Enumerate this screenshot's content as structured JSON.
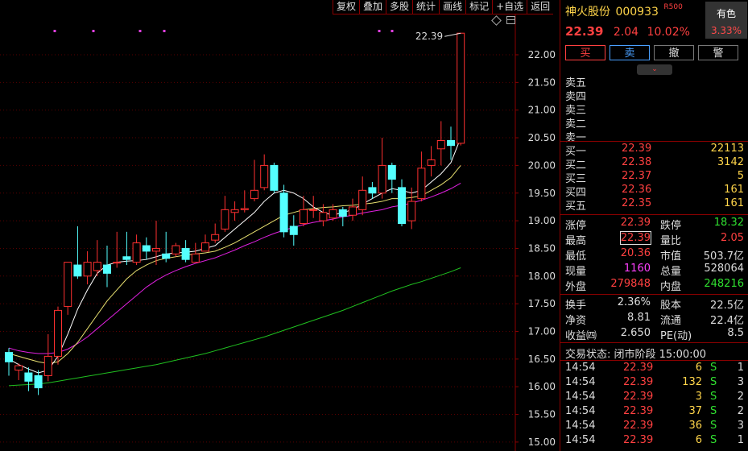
{
  "toolbar": [
    "复权",
    "叠加",
    "多股",
    "统计",
    "画线",
    "标记",
    "+自选",
    "返回"
  ],
  "chart_data": {
    "type": "candlestick",
    "y_ticks": [
      "22.00",
      "21.50",
      "21.00",
      "20.50",
      "20.00",
      "19.50",
      "19.00",
      "18.50",
      "18.00",
      "17.50",
      "17.00",
      "16.50",
      "16.00",
      "15.50",
      "15.00"
    ],
    "high_label": "22.39",
    "ylim": [
      15.0,
      22.5
    ],
    "candles": [
      [
        16.62,
        16.45,
        16.7,
        16.2
      ],
      [
        16.3,
        16.38,
        16.42,
        16.12
      ],
      [
        16.25,
        16.1,
        16.35,
        15.92
      ],
      [
        16.2,
        15.98,
        16.3,
        15.85
      ],
      [
        16.2,
        16.55,
        16.95,
        16.1
      ],
      [
        16.55,
        17.38,
        17.45,
        16.4
      ],
      [
        17.45,
        18.25,
        18.25,
        17.3
      ],
      [
        18.2,
        18.0,
        18.9,
        17.95
      ],
      [
        18.0,
        18.25,
        18.45,
        17.85
      ],
      [
        18.1,
        18.25,
        18.65,
        18.0
      ],
      [
        18.2,
        18.05,
        18.55,
        17.8
      ],
      [
        18.25,
        18.25,
        18.8,
        18.15
      ],
      [
        18.35,
        18.3,
        18.8,
        18.2
      ],
      [
        18.25,
        18.6,
        18.75,
        18.2
      ],
      [
        18.55,
        18.45,
        18.7,
        18.3
      ],
      [
        18.45,
        18.5,
        19.0,
        18.2
      ],
      [
        18.4,
        18.32,
        18.8,
        18.25
      ],
      [
        18.4,
        18.55,
        18.6,
        18.35
      ],
      [
        18.5,
        18.3,
        18.65,
        18.25
      ],
      [
        18.25,
        18.4,
        18.6,
        18.25
      ],
      [
        18.45,
        18.6,
        18.75,
        18.45
      ],
      [
        18.65,
        18.75,
        18.95,
        18.6
      ],
      [
        18.85,
        19.2,
        19.45,
        18.8
      ],
      [
        19.15,
        19.2,
        19.35,
        19.0
      ],
      [
        19.2,
        19.22,
        19.55,
        19.15
      ],
      [
        19.4,
        19.55,
        20.1,
        19.35
      ],
      [
        19.6,
        20.0,
        20.2,
        19.55
      ],
      [
        20.0,
        19.55,
        20.05,
        19.5
      ],
      [
        19.5,
        18.8,
        19.65,
        18.7
      ],
      [
        18.9,
        18.75,
        19.1,
        18.55
      ],
      [
        18.95,
        19.2,
        19.45,
        18.9
      ],
      [
        19.2,
        19.2,
        19.45,
        19.05
      ],
      [
        19.0,
        19.15,
        19.3,
        18.9
      ],
      [
        19.05,
        19.2,
        19.3,
        19.0
      ],
      [
        19.2,
        19.08,
        19.25,
        18.9
      ],
      [
        19.1,
        19.25,
        19.4,
        19.0
      ],
      [
        19.2,
        19.55,
        19.8,
        19.1
      ],
      [
        19.6,
        19.5,
        19.7,
        19.4
      ],
      [
        19.5,
        20.0,
        20.5,
        19.4
      ],
      [
        20.0,
        19.75,
        20.05,
        19.5
      ],
      [
        19.6,
        18.95,
        19.75,
        18.9
      ],
      [
        19.0,
        19.35,
        19.6,
        18.85
      ],
      [
        19.4,
        19.95,
        20.25,
        19.35
      ],
      [
        20.0,
        20.1,
        20.35,
        19.8
      ],
      [
        20.3,
        20.45,
        20.8,
        20.0
      ],
      [
        20.45,
        20.36,
        20.7,
        20.1
      ],
      [
        20.4,
        22.39,
        22.39,
        20.36
      ]
    ],
    "ma5": [
      16.5,
      16.4,
      16.32,
      16.25,
      16.3,
      16.55,
      16.95,
      17.4,
      17.75,
      18.05,
      18.2,
      18.25,
      18.27,
      18.28,
      18.3,
      18.35,
      18.4,
      18.42,
      18.43,
      18.45,
      18.5,
      18.55,
      18.7,
      18.85,
      19.0,
      19.15,
      19.35,
      19.5,
      19.55,
      19.5,
      19.4,
      19.25,
      19.15,
      19.1,
      19.15,
      19.2,
      19.3,
      19.4,
      19.5,
      19.58,
      19.55,
      19.5,
      19.55,
      19.7,
      19.85,
      20.05,
      20.5
    ],
    "ma10": [
      16.6,
      16.55,
      16.5,
      16.45,
      16.42,
      16.45,
      16.6,
      16.8,
      17.05,
      17.3,
      17.55,
      17.75,
      17.95,
      18.1,
      18.2,
      18.28,
      18.32,
      18.35,
      18.38,
      18.4,
      18.42,
      18.45,
      18.52,
      18.6,
      18.7,
      18.8,
      18.9,
      19.0,
      19.1,
      19.15,
      19.2,
      19.22,
      19.24,
      19.25,
      19.27,
      19.28,
      19.3,
      19.32,
      19.35,
      19.4,
      19.4,
      19.42,
      19.45,
      19.55,
      19.65,
      19.78,
      20.0
    ],
    "ma20": [
      16.7,
      16.65,
      16.62,
      16.6,
      16.6,
      16.62,
      16.68,
      16.78,
      16.9,
      17.05,
      17.2,
      17.35,
      17.5,
      17.65,
      17.8,
      17.92,
      18.02,
      18.1,
      18.17,
      18.23,
      18.28,
      18.33,
      18.4,
      18.47,
      18.55,
      18.62,
      18.7,
      18.77,
      18.83,
      18.88,
      18.93,
      18.97,
      19.0,
      19.03,
      19.07,
      19.1,
      19.14,
      19.17,
      19.2,
      19.25,
      19.28,
      19.32,
      19.37,
      19.43,
      19.5,
      19.58,
      19.68
    ],
    "ma60": [
      16.02,
      16.03,
      16.04,
      16.05,
      16.07,
      16.1,
      16.13,
      16.16,
      16.19,
      16.22,
      16.25,
      16.28,
      16.31,
      16.34,
      16.37,
      16.4,
      16.44,
      16.48,
      16.52,
      16.56,
      16.6,
      16.65,
      16.7,
      16.75,
      16.8,
      16.85,
      16.9,
      16.96,
      17.02,
      17.08,
      17.14,
      17.2,
      17.26,
      17.32,
      17.38,
      17.45,
      17.52,
      17.59,
      17.66,
      17.73,
      17.79,
      17.85,
      17.9,
      17.96,
      18.02,
      18.08,
      18.15
    ]
  },
  "quote": {
    "name": "神火股份",
    "code": "000933",
    "rating": "R500",
    "tag1": "有色",
    "tag2": "3.33%",
    "price": "22.39",
    "change": "2.04",
    "pct": "10.02%",
    "buttons": [
      "买",
      "卖",
      "撤",
      "警"
    ],
    "asks": [
      "卖五",
      "卖四",
      "卖三",
      "卖二",
      "卖一"
    ],
    "bids": [
      {
        "label": "买一",
        "price": "22.39",
        "vol": "22113"
      },
      {
        "label": "买二",
        "price": "22.38",
        "vol": "3142"
      },
      {
        "label": "买三",
        "price": "22.37",
        "vol": "5"
      },
      {
        "label": "买四",
        "price": "22.36",
        "vol": "161"
      },
      {
        "label": "买五",
        "price": "22.35",
        "vol": "161"
      }
    ],
    "stats": [
      {
        "l1": "涨停",
        "v1": "22.39",
        "c1": "red",
        "l2": "跌停",
        "v2": "18.32",
        "c2": "grn"
      },
      {
        "l1": "最高",
        "v1": "22.39",
        "c1": "red",
        "l2": "量比",
        "v2": "2.05",
        "c2": "red"
      },
      {
        "l1": "最低",
        "v1": "20.36",
        "c1": "red",
        "l2": "市值",
        "v2": "503.7亿",
        "c2": "wht"
      },
      {
        "l1": "现量",
        "v1": "1160",
        "c1": "mag",
        "l2": "总量",
        "v2": "528064",
        "c2": "wht"
      },
      {
        "l1": "外盘",
        "v1": "279848",
        "c1": "red",
        "l2": "内盘",
        "v2": "248216",
        "c2": "grn"
      }
    ],
    "stats2": [
      {
        "l1": "换手",
        "v1": "2.36%",
        "l2": "股本",
        "v2": "22.5亿"
      },
      {
        "l1": "净资",
        "v1": "8.81",
        "l2": "流通",
        "v2": "22.4亿"
      },
      {
        "l1": "收益㈣",
        "v1": "2.650",
        "l2": "PE(动)",
        "v2": "8.5"
      }
    ],
    "status": "交易状态: 闭市阶段 15:00:00",
    "ticks": [
      {
        "t": "14:54",
        "p": "22.39",
        "v": "6",
        "s": "S",
        "n": "1"
      },
      {
        "t": "14:54",
        "p": "22.39",
        "v": "132",
        "s": "S",
        "n": "3"
      },
      {
        "t": "14:54",
        "p": "22.39",
        "v": "3",
        "s": "S",
        "n": "2"
      },
      {
        "t": "14:54",
        "p": "22.39",
        "v": "37",
        "s": "S",
        "n": "2"
      },
      {
        "t": "14:54",
        "p": "22.39",
        "v": "36",
        "s": "S",
        "n": "3"
      },
      {
        "t": "14:54",
        "p": "22.39",
        "v": "6",
        "s": "S",
        "n": "1"
      }
    ]
  }
}
